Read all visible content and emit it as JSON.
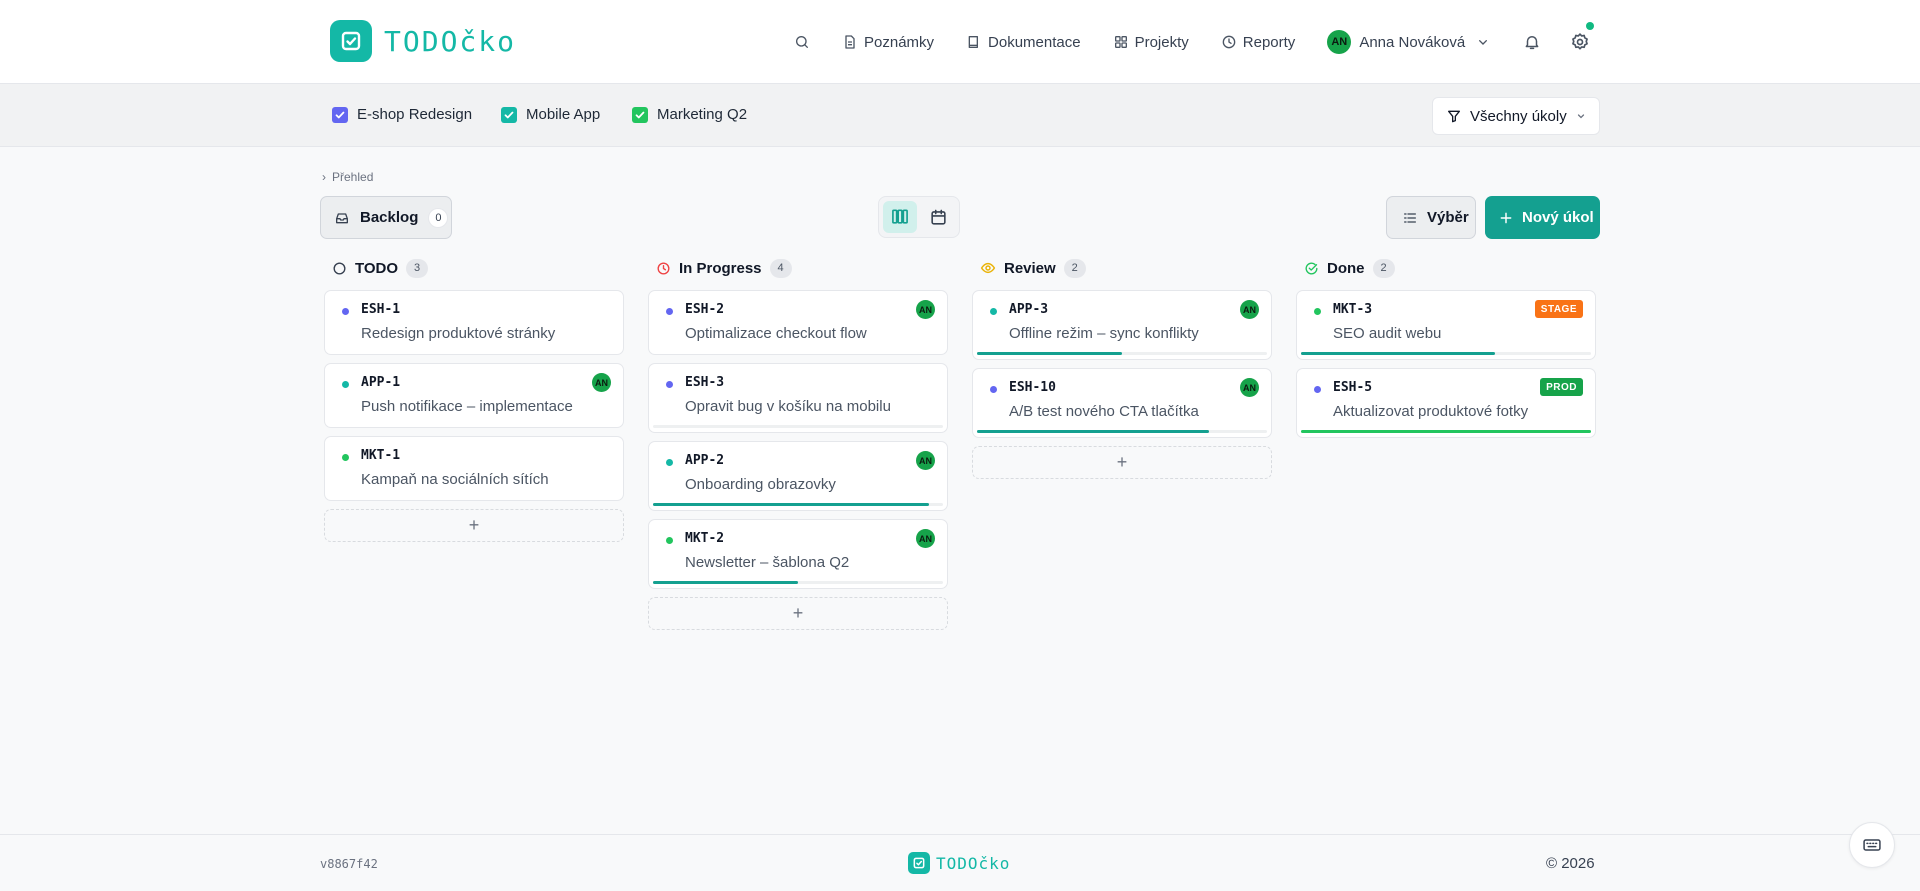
{
  "app": {
    "name": "TODOčko",
    "version": "v8867f42",
    "copyright": "© 2026"
  },
  "colors": {
    "brand": "#14b8a6",
    "accent": "#14a090",
    "esh": "#6366f1",
    "app": "#14b8a6",
    "mkt": "#22c55e"
  },
  "nav": {
    "items": [
      {
        "label": "Poznámky",
        "icon": "notes-icon"
      },
      {
        "label": "Dokumentace",
        "icon": "book-icon"
      },
      {
        "label": "Projekty",
        "icon": "grid-icon"
      },
      {
        "label": "Reporty",
        "icon": "clock-icon"
      }
    ],
    "user": {
      "initials": "AN",
      "name": "Anna Nováková"
    }
  },
  "projects": [
    {
      "label": "E-shop Redesign",
      "checked": true,
      "color": "#6366f1"
    },
    {
      "label": "Mobile App",
      "checked": true,
      "color": "#14b8a6"
    },
    {
      "label": "Marketing Q2",
      "checked": true,
      "color": "#22c55e"
    }
  ],
  "filter": {
    "label": "Všechny úkoly"
  },
  "breadcrumb": {
    "label": "Přehled"
  },
  "toolbar": {
    "backlog_label": "Backlog",
    "backlog_count": "0",
    "select_label": "Výběr",
    "new_label": "Nový úkol"
  },
  "columns": [
    {
      "title": "TODO",
      "count": "3",
      "icon": "circle-icon",
      "cards": [
        {
          "key": "ESH-1",
          "title": "Redesign produktové stránky",
          "project": "esh"
        },
        {
          "key": "APP-1",
          "title": "Push notifikace – implementace",
          "project": "app",
          "assignee": "AN"
        },
        {
          "key": "MKT-1",
          "title": "Kampaň na sociálních sítích",
          "project": "mkt"
        }
      ]
    },
    {
      "title": "In Progress",
      "count": "4",
      "icon": "clock-icon",
      "cards": [
        {
          "key": "ESH-2",
          "title": "Optimalizace checkout flow",
          "project": "esh",
          "assignee": "AN"
        },
        {
          "key": "ESH-3",
          "title": "Opravit bug v košíku na mobilu",
          "project": "esh",
          "progress": 0
        },
        {
          "key": "APP-2",
          "title": "Onboarding obrazovky",
          "project": "app",
          "assignee": "AN",
          "progress": 0.95
        },
        {
          "key": "MKT-2",
          "title": "Newsletter – šablona Q2",
          "project": "mkt",
          "assignee": "AN",
          "progress": 0.5
        }
      ]
    },
    {
      "title": "Review",
      "count": "2",
      "icon": "eye-icon",
      "cards": [
        {
          "key": "APP-3",
          "title": "Offline režim – sync konflikty",
          "project": "app",
          "assignee": "AN",
          "progress": 0.5
        },
        {
          "key": "ESH-10",
          "title": "A/B test nového CTA tlačítka",
          "project": "esh",
          "assignee": "AN",
          "progress": 0.8
        }
      ]
    },
    {
      "title": "Done",
      "count": "2",
      "icon": "check-circle-icon",
      "cards": [
        {
          "key": "MKT-3",
          "title": "SEO audit webu",
          "project": "mkt",
          "tag": "STAGE",
          "tagColor": "#f97316",
          "progress": 0.67
        },
        {
          "key": "ESH-5",
          "title": "Aktualizovat produktové fotky",
          "project": "esh",
          "tag": "PROD",
          "tagColor": "#16a34a",
          "progress": 1.0
        }
      ]
    }
  ]
}
